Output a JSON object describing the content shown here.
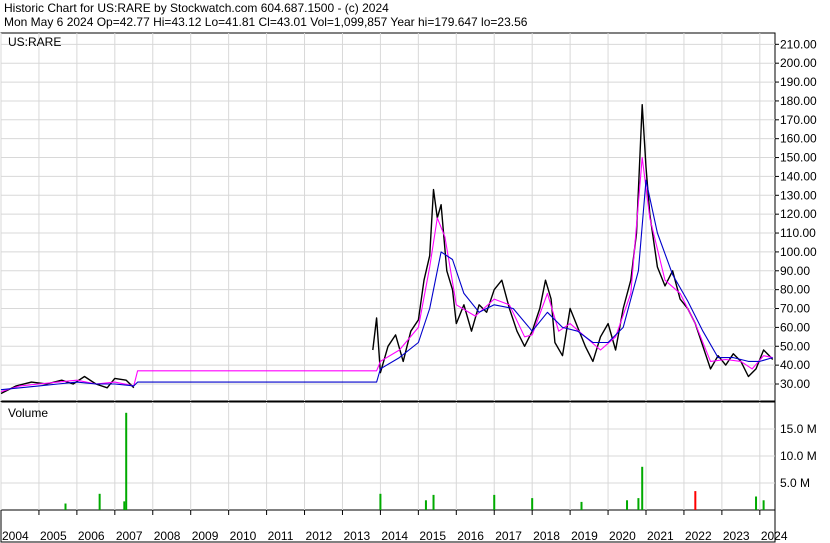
{
  "header": {
    "line1": "Historic Chart for US:RARE by Stockwatch.com 604.687.1500 - (c) 2024",
    "line2": "Mon May  6 2024   Op=42.77   Hi=43.12   Lo=41.81   Cl=43.01   Vol=1,099,857   Year hi=179.647   lo=23.56"
  },
  "chart_data": [
    {
      "type": "line",
      "label": "US:RARE",
      "y_ticks": [
        30,
        40,
        50,
        60,
        70,
        80,
        90,
        100,
        110,
        120,
        130,
        140,
        150,
        160,
        170,
        180,
        190,
        200,
        210
      ],
      "ylim": [
        21,
        216
      ],
      "xlim": [
        2004.0,
        2024.4
      ],
      "grid": true,
      "series": [
        {
          "key": "price",
          "color": "#000000",
          "points": [
            [
              2004.0,
              25
            ],
            [
              2004.4,
              29
            ],
            [
              2004.8,
              31
            ],
            [
              2005.2,
              30
            ],
            [
              2005.6,
              32
            ],
            [
              2005.9,
              30
            ],
            [
              2006.2,
              34
            ],
            [
              2006.5,
              30
            ],
            [
              2006.8,
              28
            ],
            [
              2007.0,
              33
            ],
            [
              2007.3,
              32
            ],
            [
              2007.5,
              28
            ],
            [
              2013.8,
              48
            ],
            [
              2013.9,
              65
            ],
            [
              2014.0,
              36
            ],
            [
              2014.2,
              50
            ],
            [
              2014.4,
              56
            ],
            [
              2014.6,
              42
            ],
            [
              2014.8,
              58
            ],
            [
              2015.0,
              64
            ],
            [
              2015.15,
              85
            ],
            [
              2015.3,
              98
            ],
            [
              2015.4,
              133
            ],
            [
              2015.5,
              118
            ],
            [
              2015.6,
              125
            ],
            [
              2015.75,
              90
            ],
            [
              2015.9,
              80
            ],
            [
              2016.0,
              62
            ],
            [
              2016.2,
              72
            ],
            [
              2016.4,
              58
            ],
            [
              2016.6,
              72
            ],
            [
              2016.8,
              68
            ],
            [
              2017.0,
              80
            ],
            [
              2017.2,
              85
            ],
            [
              2017.4,
              70
            ],
            [
              2017.6,
              58
            ],
            [
              2017.8,
              50
            ],
            [
              2018.0,
              58
            ],
            [
              2018.2,
              70
            ],
            [
              2018.35,
              85
            ],
            [
              2018.5,
              75
            ],
            [
              2018.6,
              52
            ],
            [
              2018.8,
              45
            ],
            [
              2019.0,
              70
            ],
            [
              2019.2,
              60
            ],
            [
              2019.4,
              50
            ],
            [
              2019.6,
              42
            ],
            [
              2019.8,
              55
            ],
            [
              2020.0,
              62
            ],
            [
              2020.2,
              48
            ],
            [
              2020.4,
              70
            ],
            [
              2020.6,
              85
            ],
            [
              2020.75,
              110
            ],
            [
              2020.9,
              178
            ],
            [
              2021.0,
              145
            ],
            [
              2021.1,
              120
            ],
            [
              2021.3,
              92
            ],
            [
              2021.5,
              82
            ],
            [
              2021.7,
              90
            ],
            [
              2021.9,
              75
            ],
            [
              2022.1,
              70
            ],
            [
              2022.3,
              62
            ],
            [
              2022.5,
              50
            ],
            [
              2022.7,
              38
            ],
            [
              2022.9,
              45
            ],
            [
              2023.1,
              40
            ],
            [
              2023.3,
              46
            ],
            [
              2023.5,
              42
            ],
            [
              2023.7,
              34
            ],
            [
              2023.9,
              38
            ],
            [
              2024.1,
              48
            ],
            [
              2024.25,
              45
            ],
            [
              2024.34,
              43
            ]
          ]
        },
        {
          "key": "ma_short",
          "color": "#ff00ff",
          "points": [
            [
              2004.0,
              26
            ],
            [
              2004.5,
              29
            ],
            [
              2005.0,
              30
            ],
            [
              2005.5,
              31
            ],
            [
              2006.0,
              32
            ],
            [
              2006.5,
              30
            ],
            [
              2007.0,
              31
            ],
            [
              2007.5,
              29
            ],
            [
              2007.6,
              37
            ],
            [
              2013.9,
              37
            ],
            [
              2014.0,
              42
            ],
            [
              2014.5,
              48
            ],
            [
              2015.0,
              60
            ],
            [
              2015.3,
              92
            ],
            [
              2015.5,
              118
            ],
            [
              2015.7,
              108
            ],
            [
              2016.0,
              72
            ],
            [
              2016.5,
              66
            ],
            [
              2017.0,
              75
            ],
            [
              2017.4,
              72
            ],
            [
              2017.8,
              55
            ],
            [
              2018.0,
              56
            ],
            [
              2018.4,
              78
            ],
            [
              2018.7,
              58
            ],
            [
              2019.0,
              62
            ],
            [
              2019.4,
              55
            ],
            [
              2019.8,
              48
            ],
            [
              2020.2,
              55
            ],
            [
              2020.6,
              78
            ],
            [
              2020.9,
              150
            ],
            [
              2021.1,
              118
            ],
            [
              2021.5,
              85
            ],
            [
              2021.9,
              78
            ],
            [
              2022.3,
              62
            ],
            [
              2022.7,
              42
            ],
            [
              2023.1,
              43
            ],
            [
              2023.5,
              42
            ],
            [
              2023.8,
              38
            ],
            [
              2024.1,
              45
            ],
            [
              2024.34,
              44
            ]
          ]
        },
        {
          "key": "ma_long",
          "color": "#0000cc",
          "points": [
            [
              2004.0,
              27
            ],
            [
              2004.5,
              28
            ],
            [
              2005.0,
              29
            ],
            [
              2005.5,
              30
            ],
            [
              2006.0,
              31
            ],
            [
              2006.5,
              30
            ],
            [
              2007.0,
              30
            ],
            [
              2007.5,
              29
            ],
            [
              2007.6,
              31
            ],
            [
              2013.9,
              31
            ],
            [
              2014.0,
              38
            ],
            [
              2014.5,
              44
            ],
            [
              2015.0,
              52
            ],
            [
              2015.3,
              70
            ],
            [
              2015.6,
              100
            ],
            [
              2015.9,
              96
            ],
            [
              2016.2,
              78
            ],
            [
              2016.6,
              68
            ],
            [
              2017.0,
              72
            ],
            [
              2017.5,
              70
            ],
            [
              2018.0,
              58
            ],
            [
              2018.4,
              68
            ],
            [
              2018.8,
              60
            ],
            [
              2019.2,
              58
            ],
            [
              2019.6,
              52
            ],
            [
              2020.0,
              52
            ],
            [
              2020.4,
              60
            ],
            [
              2020.8,
              90
            ],
            [
              2021.0,
              138
            ],
            [
              2021.3,
              110
            ],
            [
              2021.7,
              88
            ],
            [
              2022.1,
              74
            ],
            [
              2022.5,
              58
            ],
            [
              2022.9,
              44
            ],
            [
              2023.3,
              44
            ],
            [
              2023.7,
              42
            ],
            [
              2024.0,
              42
            ],
            [
              2024.34,
              44
            ]
          ]
        }
      ]
    },
    {
      "type": "bar",
      "label": "Volume",
      "y_ticks": [
        {
          "value": 5.0,
          "label": "5.0 M"
        },
        {
          "value": 10.0,
          "label": "10.0 M"
        },
        {
          "value": 15.0,
          "label": "15.0 M"
        }
      ],
      "ylim": [
        0,
        20
      ],
      "unit": "M",
      "up_color": "#00aa00",
      "down_color": "#ff0000",
      "spikes": [
        [
          2005.7,
          1.2,
          "up"
        ],
        [
          2006.6,
          3.0,
          "up"
        ],
        [
          2007.3,
          18.0,
          "up"
        ],
        [
          2007.25,
          1.6,
          "up"
        ],
        [
          2014.0,
          3.0,
          "up"
        ],
        [
          2015.2,
          1.8,
          "up"
        ],
        [
          2015.4,
          2.8,
          "up"
        ],
        [
          2017.0,
          2.8,
          "up"
        ],
        [
          2018.0,
          2.2,
          "up"
        ],
        [
          2019.3,
          1.5,
          "up"
        ],
        [
          2020.5,
          1.8,
          "up"
        ],
        [
          2020.8,
          2.2,
          "up"
        ],
        [
          2020.9,
          8.0,
          "up"
        ],
        [
          2022.3,
          3.5,
          "down"
        ],
        [
          2023.9,
          2.5,
          "up"
        ],
        [
          2024.1,
          1.8,
          "up"
        ]
      ]
    }
  ],
  "x_axis": {
    "labels": [
      "2004",
      "2005",
      "2006",
      "2007",
      "2008",
      "2009",
      "2010",
      "2011",
      "2012",
      "2013",
      "2014",
      "2015",
      "2016",
      "2017",
      "2018",
      "2019",
      "2020",
      "2021",
      "2022",
      "2023",
      "2024"
    ]
  }
}
